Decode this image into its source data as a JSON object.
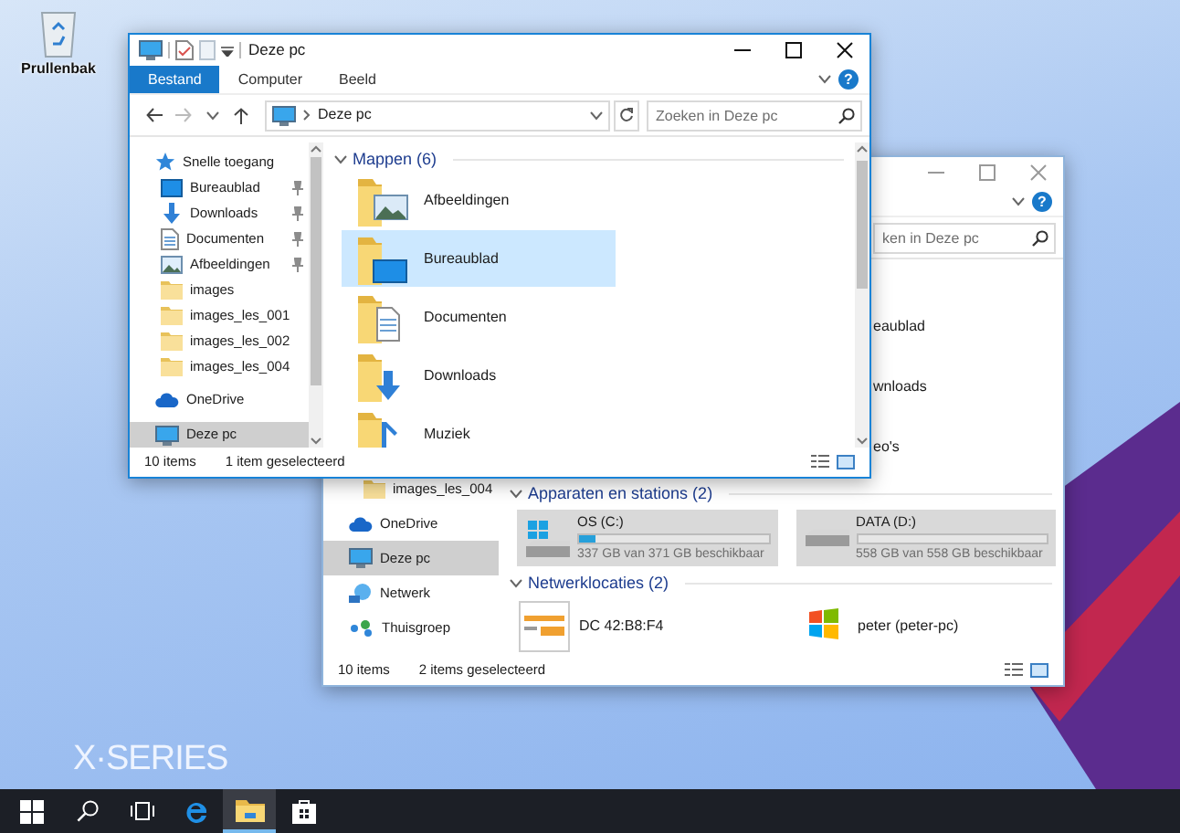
{
  "desktop": {
    "icons": [
      {
        "label": "Prullenbak",
        "kind": "recycle-bin"
      }
    ],
    "wallpaper_text": "X·SERIES"
  },
  "front_window": {
    "active": true,
    "title": "Deze pc",
    "ribbon_tabs": [
      {
        "label": "Bestand",
        "kind": "file"
      },
      {
        "label": "Computer",
        "kind": "tab"
      },
      {
        "label": "Beeld",
        "kind": "tab"
      }
    ],
    "help": "?",
    "address": "Deze pc",
    "search": {
      "placeholder": "Zoeken in Deze pc"
    },
    "sidebar": {
      "items": [
        {
          "label": "Snelle toegang",
          "kind": "star",
          "selected": false,
          "children": [
            {
              "label": "Bureaublad",
              "kind": "desktop",
              "pinned": true,
              "selected": false
            },
            {
              "label": "Downloads",
              "kind": "download",
              "pinned": true,
              "selected": false
            },
            {
              "label": "Documenten",
              "kind": "document",
              "pinned": true,
              "selected": false
            },
            {
              "label": "Afbeeldingen",
              "kind": "picture",
              "pinned": true,
              "selected": false
            },
            {
              "label": "images",
              "kind": "folder",
              "pinned": false,
              "selected": false
            },
            {
              "label": "images_les_001",
              "kind": "folder",
              "pinned": false,
              "selected": false
            },
            {
              "label": "images_les_002",
              "kind": "folder",
              "pinned": false,
              "selected": false
            },
            {
              "label": "images_les_004",
              "kind": "folder",
              "pinned": false,
              "selected": false
            }
          ]
        },
        {
          "label": "OneDrive",
          "kind": "cloud",
          "selected": false
        },
        {
          "label": "Deze pc",
          "kind": "pc",
          "selected": true
        }
      ]
    },
    "section": {
      "title": "Mappen (6)",
      "expanded": true
    },
    "folders": [
      {
        "label": "Afbeeldingen",
        "kind": "picture",
        "selected": false
      },
      {
        "label": "Bureaublad",
        "kind": "desktop",
        "selected": true
      },
      {
        "label": "Documenten",
        "kind": "document",
        "selected": false
      },
      {
        "label": "Downloads",
        "kind": "download",
        "selected": false
      },
      {
        "label": "Muziek",
        "kind": "music",
        "selected": false
      }
    ],
    "status_bar": {
      "count": "10 items",
      "selection": "1 item geselecteerd"
    }
  },
  "back_window": {
    "active": false,
    "help": "?",
    "search": {
      "placeholder": "ken in Deze pc"
    },
    "folders": [
      {
        "label": "eaublad",
        "selected": false
      },
      {
        "label": "wnloads",
        "selected": false
      },
      {
        "label": "eo's",
        "selected": false
      }
    ],
    "sidebar": {
      "items": [
        {
          "label": "images_les_004",
          "kind": "folder",
          "selected": false
        },
        {
          "label": "OneDrive",
          "kind": "cloud",
          "selected": false
        },
        {
          "label": "Deze pc",
          "kind": "pc",
          "selected": true
        },
        {
          "label": "Netwerk",
          "kind": "network",
          "selected": false
        },
        {
          "label": "Thuisgroep",
          "kind": "homegroup",
          "selected": false
        }
      ]
    },
    "devices": {
      "title": "Apparaten en stations (2)",
      "expanded": true,
      "drives": [
        {
          "name": "OS (C:)",
          "kind": "system",
          "level": 0.09,
          "free_space": "337 GB van 371 GB beschikbaar",
          "selected": true
        },
        {
          "name": "DATA (D:)",
          "kind": "data",
          "level": 0,
          "free_space": "558 GB van 558 GB beschikbaar",
          "selected": true
        }
      ]
    },
    "network": {
      "title": "Netwerklocaties (2)",
      "expanded": true,
      "places": [
        {
          "label": "DC 42:B8:F4",
          "kind": "device",
          "selected": false
        },
        {
          "label": "peter (peter-pc)",
          "kind": "media",
          "selected": false
        }
      ]
    },
    "status_bar": {
      "count": "10 items",
      "selection": "2 items geselecteerd"
    }
  },
  "taskbar": {
    "items": [
      {
        "kind": "start",
        "selected": false
      },
      {
        "kind": "search",
        "selected": false
      },
      {
        "kind": "taskview",
        "selected": false
      },
      {
        "kind": "edge",
        "selected": false
      },
      {
        "kind": "explorer",
        "selected": true
      },
      {
        "kind": "store",
        "selected": false
      }
    ]
  }
}
